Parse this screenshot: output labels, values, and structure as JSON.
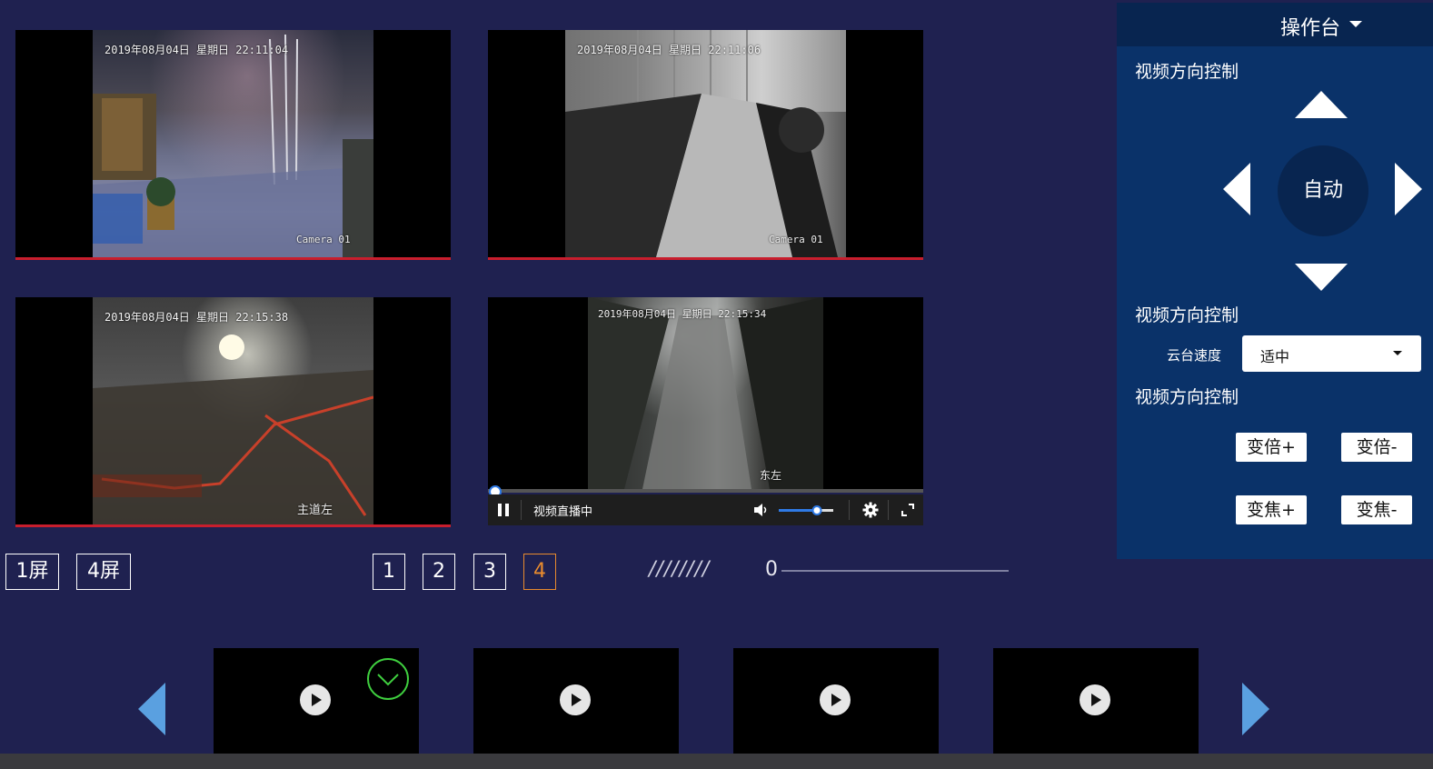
{
  "cameras": [
    {
      "timestamp": "2019年08月04日  星期日  22:11:04",
      "label": "Camera 01"
    },
    {
      "timestamp": "2019年08月04日  星期日  22:11:06",
      "label": "Camera 01"
    },
    {
      "timestamp": "2019年08月04日  星期日  22:15:38",
      "label": "主道左"
    },
    {
      "timestamp": "2019年08月04日  星期日  22:15:34",
      "label": "东左"
    }
  ],
  "player": {
    "status": "视频直播中",
    "volume": 0.7,
    "progress": 0.0
  },
  "layout_buttons": [
    "1屏",
    "4屏"
  ],
  "pages": [
    "1",
    "2",
    "3",
    "4"
  ],
  "active_page": "4",
  "slider": {
    "value_label": "0",
    "hatch": "////////"
  },
  "panel": {
    "title": "操作台",
    "section1": "视频方向控制",
    "auto_label": "自动",
    "section2": "视频方向控制",
    "speed_label": "云台速度",
    "speed_value": "适中",
    "section3": "视频方向控制",
    "zoom_in": "变倍+",
    "zoom_out": "变倍-",
    "focus_in": "变焦+",
    "focus_out": "变焦-"
  },
  "colors": {
    "background": "#1f2150",
    "panel": "#0a3269",
    "accent": "#e88b2e",
    "underline": "#c81e2d",
    "arrow": "#5aa0e0"
  }
}
